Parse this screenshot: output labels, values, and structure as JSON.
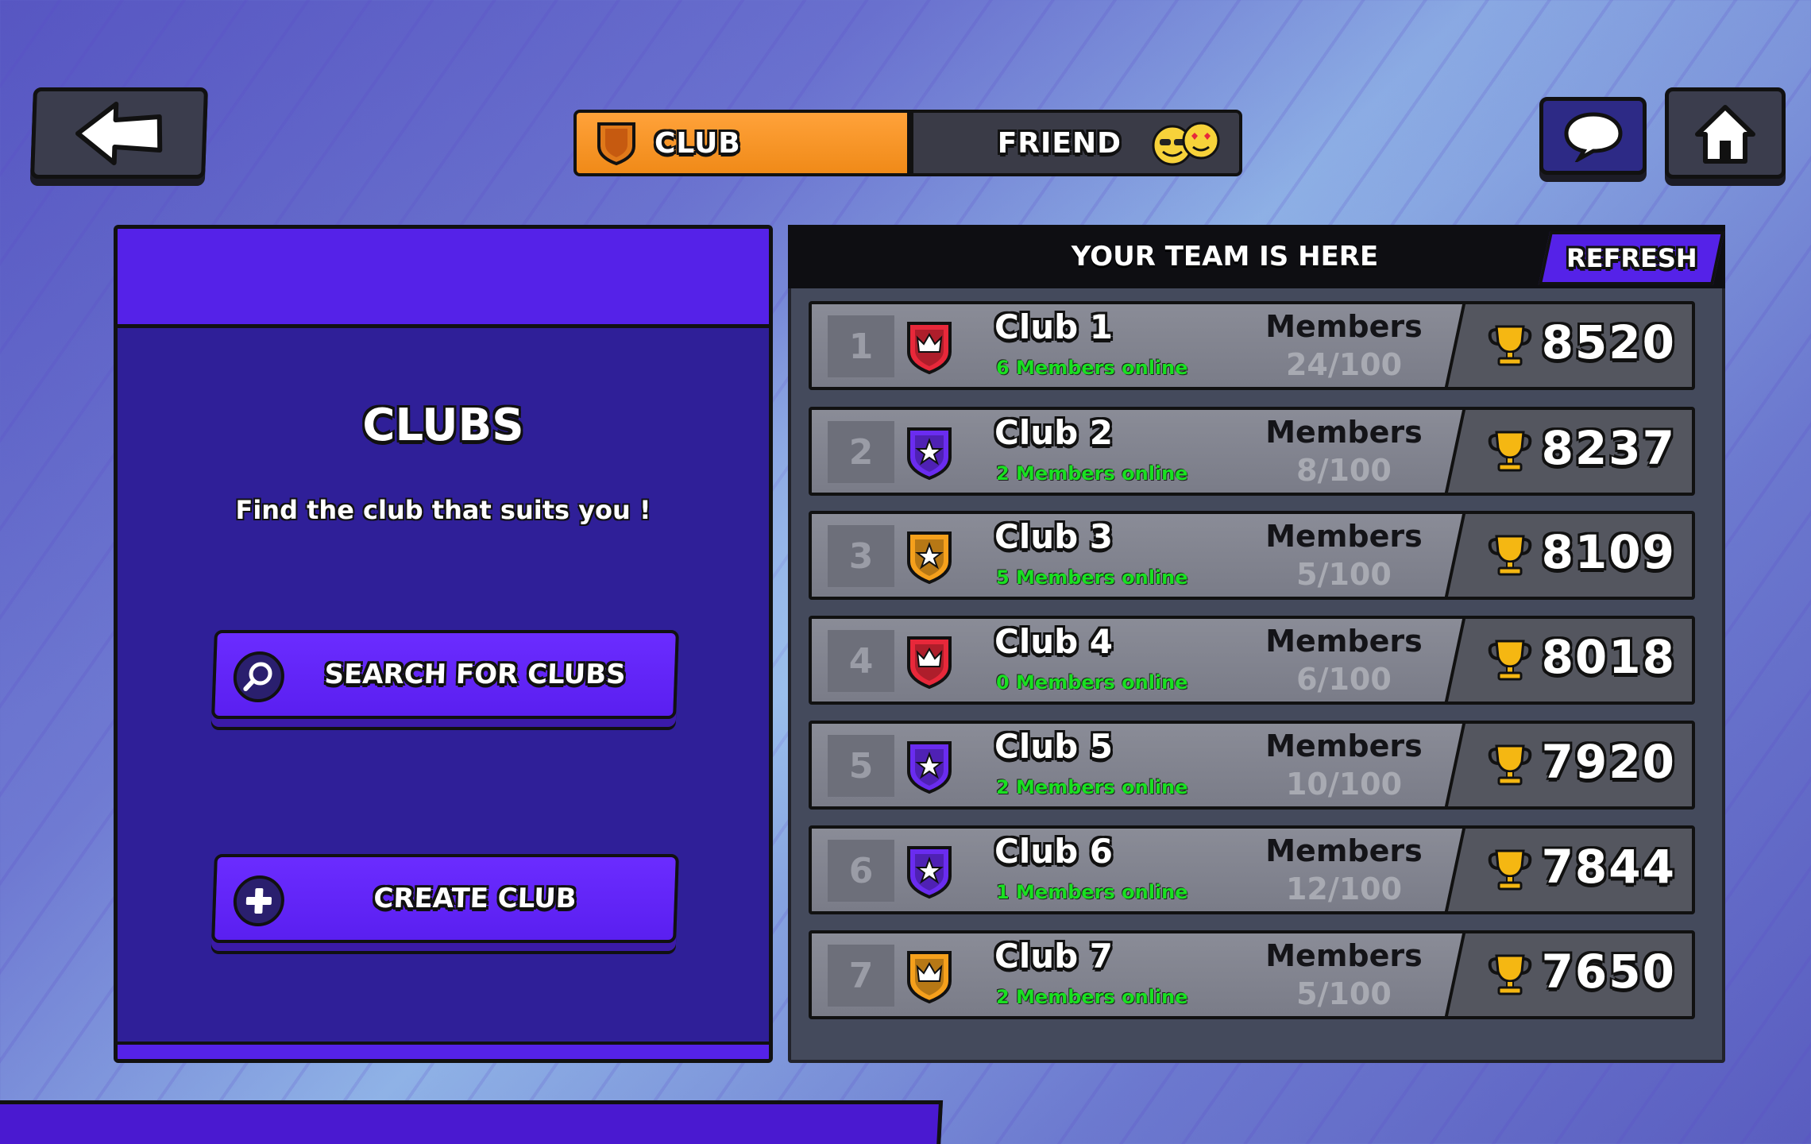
{
  "tabs": {
    "club_label": "CLUB",
    "friend_label": "FRIEND"
  },
  "left_panel": {
    "title": "CLUBS",
    "subtitle": "Find the club that suits you !",
    "search_label": "SEARCH FOR CLUBS",
    "create_label": "CREATE CLUB"
  },
  "right_panel": {
    "title": "YOUR TEAM IS HERE",
    "refresh_label": "REFRESH",
    "members_label": "Members"
  },
  "clubs": [
    {
      "rank": "1",
      "name": "Club 1",
      "online": "6 Members online",
      "members": "24/100",
      "score": "8520",
      "badge": "crown-red-badge",
      "badge_color": "#e8283a"
    },
    {
      "rank": "2",
      "name": "Club 2",
      "online": "2 Members online",
      "members": "8/100",
      "score": "8237",
      "badge": "star-purple-badge",
      "badge_color": "#6a2cf0"
    },
    {
      "rank": "3",
      "name": "Club 3",
      "online": "5 Members online",
      "members": "5/100",
      "score": "8109",
      "badge": "star-orange-badge",
      "badge_color": "#f5a01c"
    },
    {
      "rank": "4",
      "name": "Club 4",
      "online": "0 Members online",
      "members": "6/100",
      "score": "8018",
      "badge": "crown-red-badge",
      "badge_color": "#e8283a"
    },
    {
      "rank": "5",
      "name": "Club 5",
      "online": "2 Members online",
      "members": "10/100",
      "score": "7920",
      "badge": "star-purple-badge",
      "badge_color": "#6a2cf0"
    },
    {
      "rank": "6",
      "name": "Club 6",
      "online": "1 Members online",
      "members": "12/100",
      "score": "7844",
      "badge": "star-purple-badge",
      "badge_color": "#6a2cf0"
    },
    {
      "rank": "7",
      "name": "Club 7",
      "online": "2 Members online",
      "members": "5/100",
      "score": "7650",
      "badge": "crown-orange-badge",
      "badge_color": "#f5a01c"
    }
  ],
  "colors": {
    "accent_purple": "#5522e8",
    "tab_orange": "#f39423",
    "online_green": "#19e021",
    "trophy_gold": "#f5b712"
  }
}
